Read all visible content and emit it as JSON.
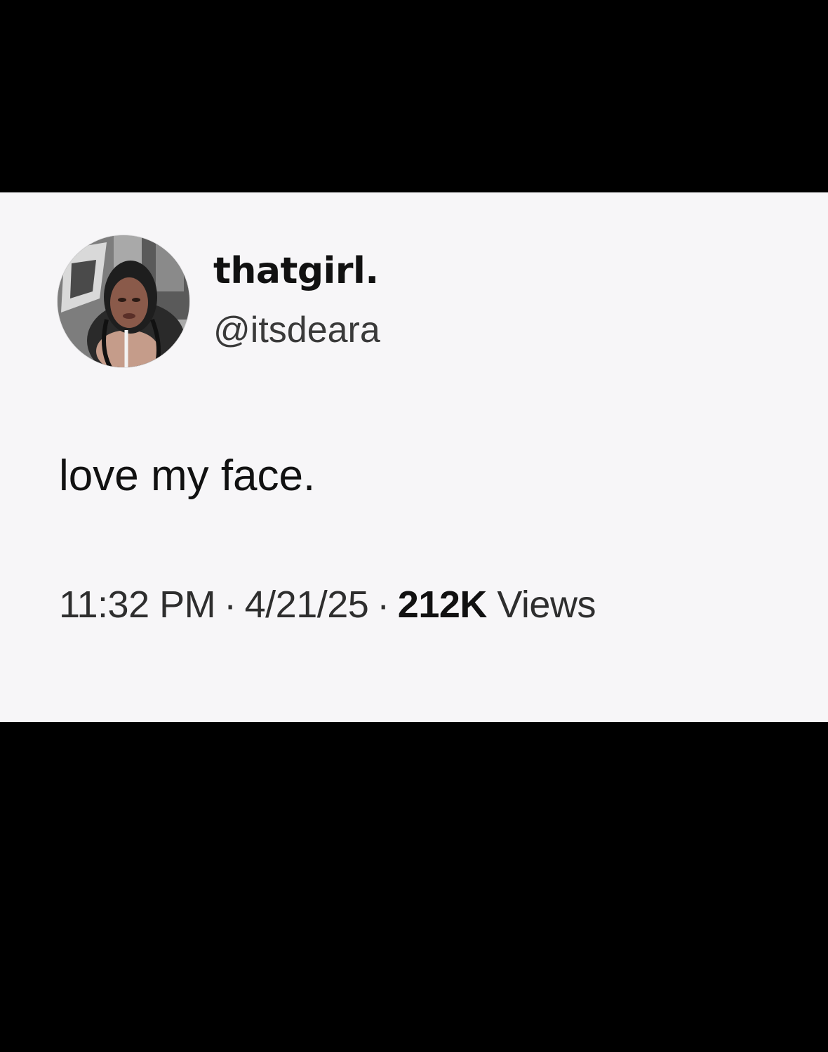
{
  "colors": {
    "background": "#000000",
    "card": "#f7f6f8",
    "text_primary": "#111111",
    "text_secondary": "#3a3a3a"
  },
  "tweet": {
    "avatar_icon": "user-photo-avatar",
    "display_name": "thatgirl.",
    "handle": "@itsdeara",
    "text": "love my face.",
    "time": "11:32 PM",
    "separator": "·",
    "date": "4/21/25",
    "views_count": "212K",
    "views_label": "Views"
  }
}
